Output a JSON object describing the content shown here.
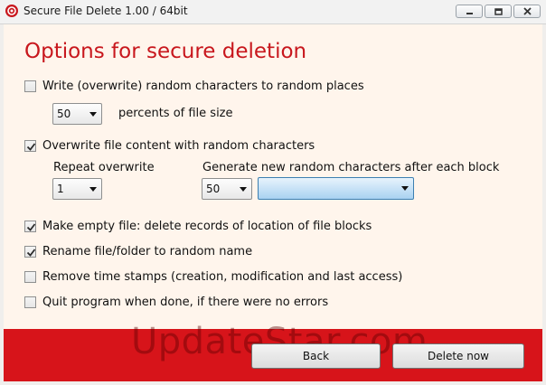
{
  "window": {
    "title": "Secure File Delete 1.00 / 64bit",
    "icon": "gear-icon",
    "controls": [
      "minimize-icon",
      "restore-icon",
      "close-icon"
    ]
  },
  "main": {
    "heading": "Options for secure deletion",
    "options": {
      "write_random": {
        "label": "Write (overwrite) random characters to random places",
        "checked": false
      },
      "percent_select": {
        "value": "50"
      },
      "percent_label": "percents of file size",
      "overwrite_content": {
        "label": "Overwrite file content with random characters",
        "checked": true
      },
      "repeat_label": "Repeat overwrite",
      "repeat_select": {
        "value": "1"
      },
      "generate_label": "Generate new random characters after each block",
      "generate_select": {
        "value": "50"
      },
      "generate_unit_select": {
        "value": ""
      },
      "make_empty": {
        "label": "Make empty file: delete records of location of file blocks",
        "checked": true
      },
      "rename": {
        "label": "Rename file/folder to random name",
        "checked": true
      },
      "remove_timestamps": {
        "label": "Remove time stamps (creation, modification and last access)",
        "checked": false
      },
      "quit_when_done": {
        "label": "Quit program when done, if there were no errors",
        "checked": false
      }
    }
  },
  "footer": {
    "watermark": "UpdateStar.com",
    "back_label": "Back",
    "delete_label": "Delete now"
  },
  "colors": {
    "accent": "#c8171d",
    "footer_bg": "#d7141a",
    "client_bg": "#fff5ec"
  }
}
